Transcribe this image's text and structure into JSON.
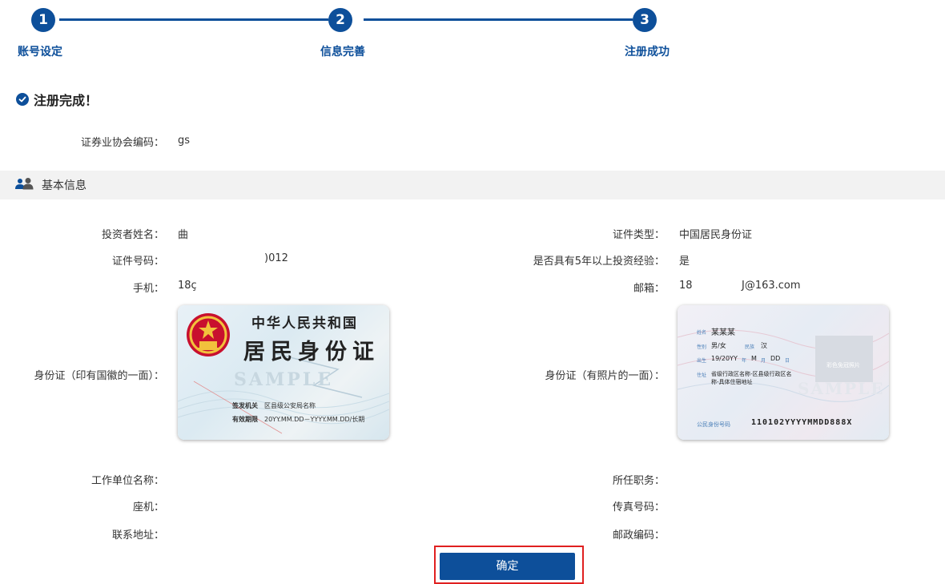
{
  "stepper": {
    "steps": [
      {
        "number": "1",
        "label": "账号设定"
      },
      {
        "number": "2",
        "label": "信息完善"
      },
      {
        "number": "3",
        "label": "注册成功"
      }
    ]
  },
  "success": {
    "title": "注册完成！"
  },
  "association_code": {
    "label": "证券业协会编码：",
    "value": "gs"
  },
  "basic_info": {
    "section_title": "基本信息",
    "investor_name": {
      "label": "投资者姓名：",
      "value": "曲"
    },
    "id_type": {
      "label": "证件类型：",
      "value": "中国居民身份证"
    },
    "id_number": {
      "label": "证件号码：",
      "value": ")012"
    },
    "investment_experience": {
      "label": "是否具有5年以上投资经验：",
      "value": "是"
    },
    "mobile": {
      "label": "手机：",
      "value": "18ç"
    },
    "email": {
      "label": "邮箱：",
      "value_prefix": "18",
      "value_suffix": "J@163.com"
    },
    "id_front": {
      "label": "身份证（印有国徽的一面）："
    },
    "id_back": {
      "label": "身份证（有照片的一面）："
    },
    "work_unit": {
      "label": "工作单位名称：",
      "value": ""
    },
    "position": {
      "label": "所任职务：",
      "value": ""
    },
    "landline": {
      "label": "座机：",
      "value": ""
    },
    "fax": {
      "label": "传真号码：",
      "value": ""
    },
    "address": {
      "label": "联系地址：",
      "value": ""
    },
    "postal_code": {
      "label": "邮政编码：",
      "value": ""
    }
  },
  "id_card_front": {
    "country": "中华人民共和国",
    "title": "居民身份证",
    "watermark": "SAMPLE",
    "authority_label": "签发机关",
    "authority_value": "区县级公安局名称",
    "validity_label": "有效期限",
    "validity_value": "20YY.MM.DD－YYYY.MM.DD/长期"
  },
  "id_card_back": {
    "name_label": "姓名",
    "name_value": "某某某",
    "sex_label": "性别",
    "sex_value": "男/女",
    "ethnicity_label": "民族",
    "ethnicity_value": "汉",
    "birth_label": "出生",
    "birth_year": "19/20YY",
    "year_unit": "年",
    "birth_month": "M",
    "month_unit": "月",
    "birth_day": "DD",
    "day_unit": "日",
    "address_label": "住址",
    "address_line1": "省级行政区名称-区县级行政区名",
    "address_line2": "称-具体住宿地址",
    "photo_text": "彩色免冠照片",
    "id_label": "公民身份号码",
    "id_value": "110102YYYYMMDD888X",
    "watermark": "SAMPLE"
  },
  "confirm": {
    "label": "确定"
  },
  "colors": {
    "primary": "#0d4f9a",
    "highlight_frame": "#e02020",
    "section_bg": "#f2f2f2"
  }
}
